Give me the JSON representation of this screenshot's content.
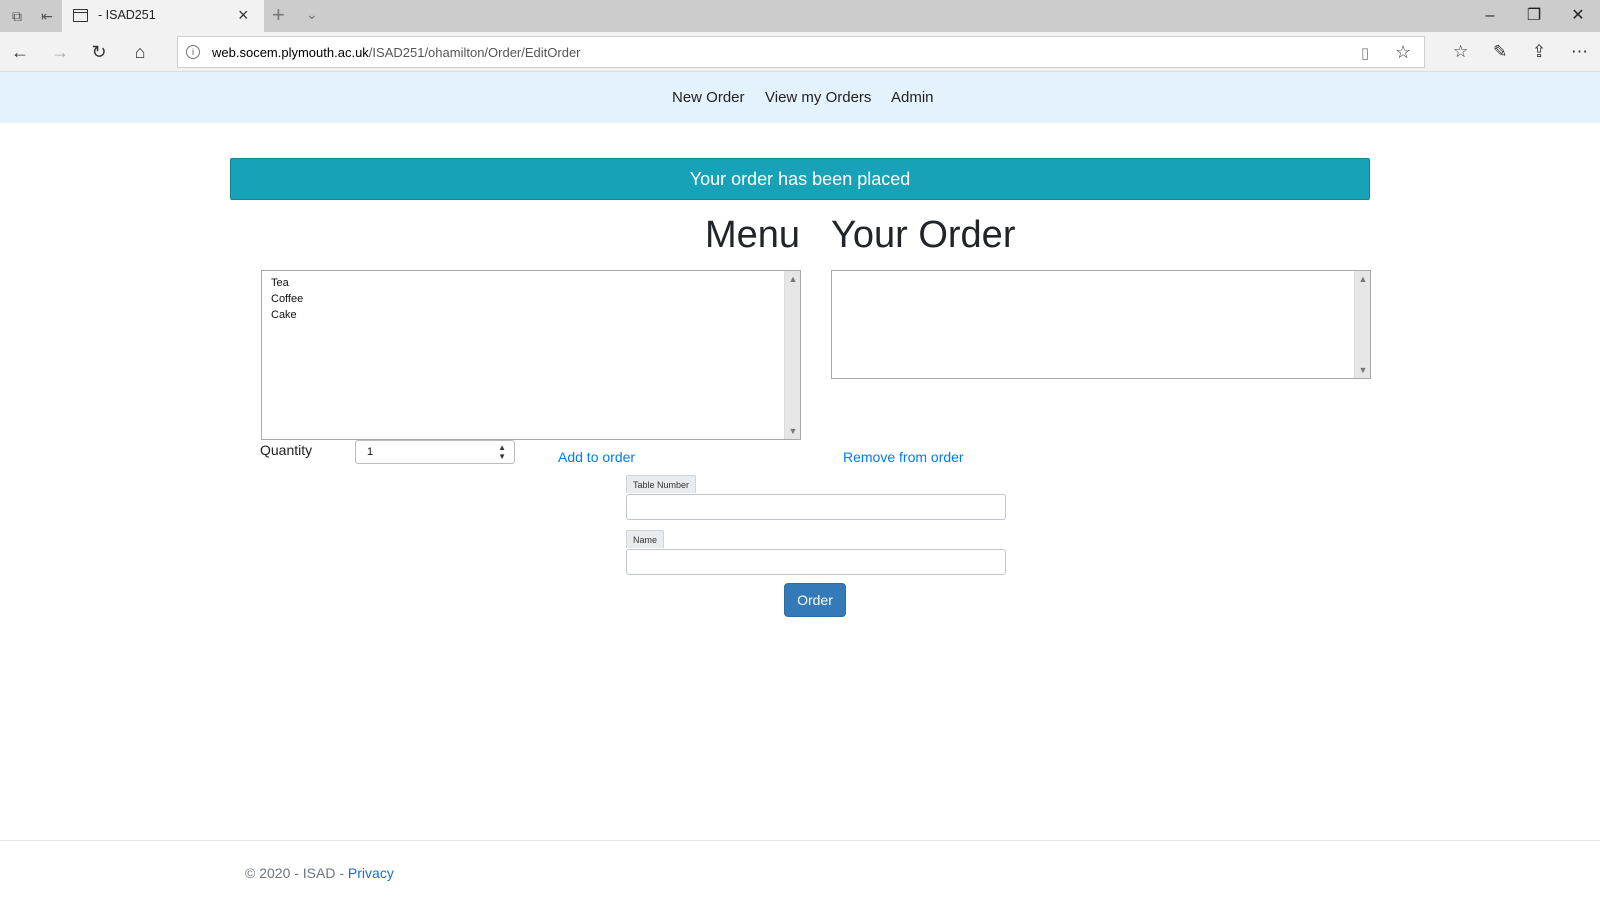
{
  "browser": {
    "tab_title": "- ISAD251",
    "url_host": "web.socem.plymouth.ac.uk",
    "url_path": "/ISAD251/ohamilton/Order/EditOrder"
  },
  "nav": {
    "items": [
      "New Order",
      "View my Orders",
      "Admin"
    ]
  },
  "alert": {
    "message": "Your order has been placed",
    "color": "#17a2b8"
  },
  "menu": {
    "heading": "Menu",
    "items": [
      "Tea",
      "Coffee",
      "Cake"
    ]
  },
  "your_order": {
    "heading": "Your Order",
    "items": []
  },
  "quantity": {
    "label": "Quantity",
    "value": "1"
  },
  "actions": {
    "add": "Add to order",
    "remove": "Remove from order",
    "order_button": "Order"
  },
  "form": {
    "table_number_label": "Table Number",
    "table_number_value": "",
    "name_label": "Name",
    "name_value": ""
  },
  "footer": {
    "text": "© 2020 - ISAD - ",
    "privacy_link": "Privacy"
  },
  "colors": {
    "nav_bg": "#e3f2fd",
    "link": "#007bff",
    "button": "#337ab7"
  }
}
